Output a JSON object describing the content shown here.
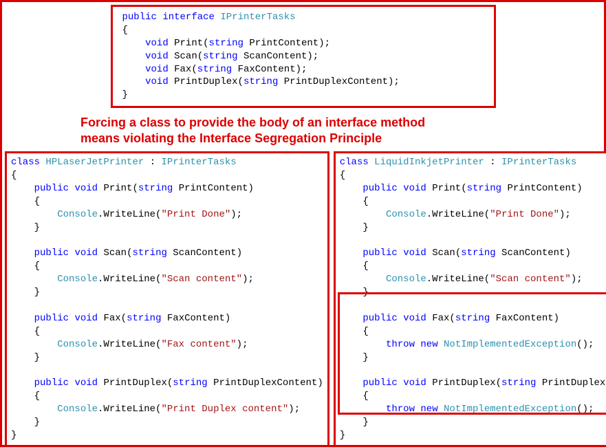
{
  "caption": {
    "line1": "Forcing a class to provide the body of an interface method",
    "line2": "means violating the Interface Segregation Principle"
  },
  "interface": {
    "kw_public": "public",
    "kw_interface": "interface",
    "name": "IPrinterTasks",
    "open": "{",
    "close": "}",
    "methods": {
      "m1_kw": "void",
      "m1_name": "Print",
      "m1_ptype": "string",
      "m1_pname": "PrintContent",
      "m2_kw": "void",
      "m2_name": "Scan",
      "m2_ptype": "string",
      "m2_pname": "ScanContent",
      "m3_kw": "void",
      "m3_name": "Fax",
      "m3_ptype": "string",
      "m3_pname": "FaxContent",
      "m4_kw": "void",
      "m4_name": "PrintDuplex",
      "m4_ptype": "string",
      "m4_pname": "PrintDuplexContent"
    }
  },
  "left": {
    "kw_class": "class",
    "classname": "HPLaserJetPrinter",
    "colon": " : ",
    "iface": "IPrinterTasks",
    "open": "{",
    "close": "}",
    "m1": {
      "kw_public": "public",
      "kw_void": "void",
      "name": "Print",
      "ptype": "string",
      "pname": "PrintContent",
      "body_call": "Console",
      "body_dot": ".WriteLine(",
      "body_str": "\"Print Done\"",
      "body_end": ");"
    },
    "m2": {
      "kw_public": "public",
      "kw_void": "void",
      "name": "Scan",
      "ptype": "string",
      "pname": "ScanContent",
      "body_call": "Console",
      "body_dot": ".WriteLine(",
      "body_str": "\"Scan content\"",
      "body_end": ");"
    },
    "m3": {
      "kw_public": "public",
      "kw_void": "void",
      "name": "Fax",
      "ptype": "string",
      "pname": "FaxContent",
      "body_call": "Console",
      "body_dot": ".WriteLine(",
      "body_str": "\"Fax content\"",
      "body_end": ");"
    },
    "m4": {
      "kw_public": "public",
      "kw_void": "void",
      "name": "PrintDuplex",
      "ptype": "string",
      "pname": "PrintDuplexContent",
      "body_call": "Console",
      "body_dot": ".WriteLine(",
      "body_str": "\"Print Duplex content\"",
      "body_end": ");"
    }
  },
  "right": {
    "kw_class": "class",
    "classname": "LiquidInkjetPrinter",
    "colon": " : ",
    "iface": "IPrinterTasks",
    "open": "{",
    "close": "}",
    "m1": {
      "kw_public": "public",
      "kw_void": "void",
      "name": "Print",
      "ptype": "string",
      "pname": "PrintContent",
      "body_call": "Console",
      "body_dot": ".WriteLine(",
      "body_str": "\"Print Done\"",
      "body_end": ");"
    },
    "m2": {
      "kw_public": "public",
      "kw_void": "void",
      "name": "Scan",
      "ptype": "string",
      "pname": "ScanContent",
      "body_call": "Console",
      "body_dot": ".WriteLine(",
      "body_str": "\"Scan content\"",
      "body_end": ");"
    },
    "m3": {
      "kw_public": "public",
      "kw_void": "void",
      "name": "Fax",
      "ptype": "string",
      "pname": "FaxContent",
      "throw_kw": "throw",
      "new_kw": "new",
      "exc": "NotImplementedException",
      "end": "();"
    },
    "m4": {
      "kw_public": "public",
      "kw_void": "void",
      "name": "PrintDuplex",
      "ptype": "string",
      "pname": "PrintDuplexContent",
      "throw_kw": "throw",
      "new_kw": "new",
      "exc": "NotImplementedException",
      "end": "();"
    }
  }
}
